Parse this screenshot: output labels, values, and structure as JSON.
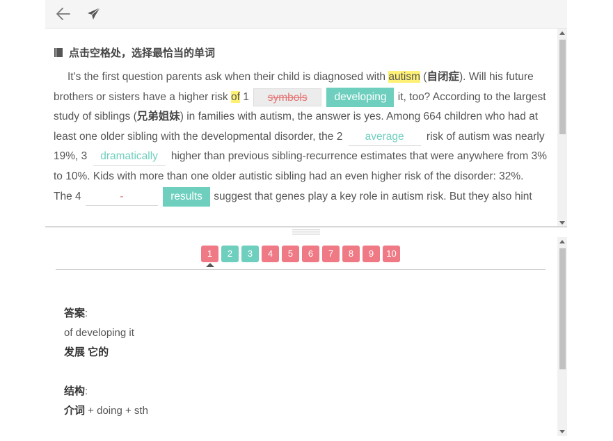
{
  "toolbar": {
    "back_icon": "arrow-left-icon",
    "send_icon": "paper-plane-icon"
  },
  "header": {
    "title": "点击空格处，选择最恰当的单词",
    "icon": "book-icon"
  },
  "passage": {
    "s1": "It's the first question parents ask when their child is diagnosed with ",
    "w_autism": "autism",
    "s2": " (",
    "cn_autism": "自闭症",
    "s3": "). Will his future brothers or sisters have a higher risk ",
    "w_of": "of",
    "n1": " 1 ",
    "blank1_wrong": "symbols",
    "blank1_correct": "developing",
    "s4": " it, too? According to the largest study of siblings (",
    "cn_siblings": "兄弟姐妹",
    "s5": ") in families with autism, the answer is yes. Among 664 children who had at least one older sibling with the developmental disorder, the 2 ",
    "blank2": "average",
    "s6": " risk of autism was nearly 19%, 3 ",
    "blank3": "dramatically",
    "s7": " higher than previous sibling-recurrence estimates that were anywhere from 3% to 10%. Kids with more than one older autistic sibling had an even higher risk of the disorder: 32%.",
    "s8": "The 4 ",
    "blank4": "-",
    "blank4_correct": "results",
    "s9": " suggest that genes play a key role in autism risk. But they also hint"
  },
  "questions": [
    {
      "label": "1",
      "status": "wrong"
    },
    {
      "label": "2",
      "status": "correct"
    },
    {
      "label": "3",
      "status": "correct"
    },
    {
      "label": "4",
      "status": "wrong"
    },
    {
      "label": "5",
      "status": "wrong"
    },
    {
      "label": "6",
      "status": "wrong"
    },
    {
      "label": "7",
      "status": "wrong"
    },
    {
      "label": "8",
      "status": "wrong"
    },
    {
      "label": "9",
      "status": "wrong"
    },
    {
      "label": "10",
      "status": "wrong"
    }
  ],
  "answer": {
    "label": "答案",
    "colon": ":",
    "phrase": "of developing it",
    "meaning": "发展 它的",
    "structure_label": "结构",
    "structure_cn": "介词",
    "structure_rest": " + doing + sth"
  },
  "colors": {
    "teal": "#6ecfbe",
    "red": "#ef7a85",
    "highlight": "#fff176"
  }
}
